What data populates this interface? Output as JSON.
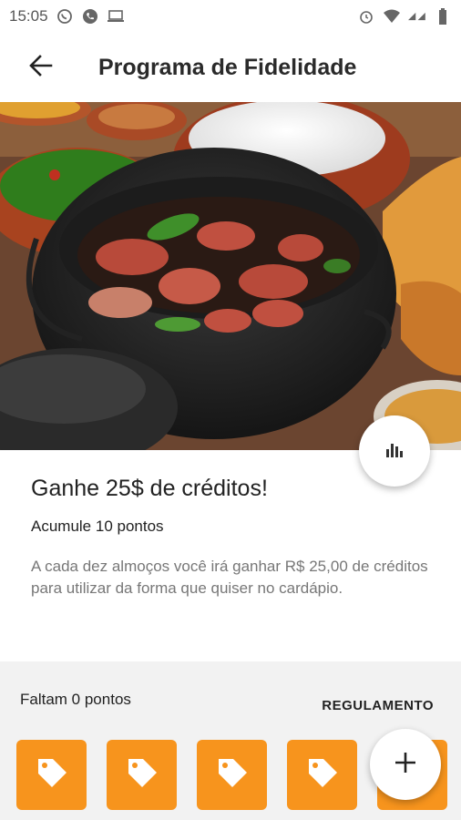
{
  "status_bar": {
    "time": "15:05",
    "icons": [
      "whatsapp-icon",
      "phone-icon",
      "laptop-icon",
      "alarm-icon",
      "wifi-icon",
      "signal-icon",
      "battery-icon"
    ]
  },
  "header": {
    "title": "Programa de Fidelidade",
    "back_icon": "arrow-left-icon"
  },
  "hero": {
    "subject": "feijoada-food-photo"
  },
  "reward": {
    "title": "Ganhe 25$ de créditos!",
    "subtitle": "Acumule 10 pontos",
    "description": "A cada dez almoços você irá ganhar R$ 25,00 de créditos para utilizar da forma que quiser no cardápio."
  },
  "points": {
    "remaining_label": "Faltam 0 pontos",
    "rules_label": "REGULAMENTO",
    "stamps": [
      {
        "icon": "tag-icon"
      },
      {
        "icon": "tag-icon"
      },
      {
        "icon": "tag-icon"
      },
      {
        "icon": "tag-icon"
      },
      {
        "icon": "tag-icon"
      }
    ]
  },
  "fabs": {
    "stats_icon": "bar-chart-icon",
    "add_icon": "plus-icon"
  },
  "colors": {
    "accent": "#f7941d",
    "background": "#f2f2f2",
    "surface": "#ffffff"
  }
}
